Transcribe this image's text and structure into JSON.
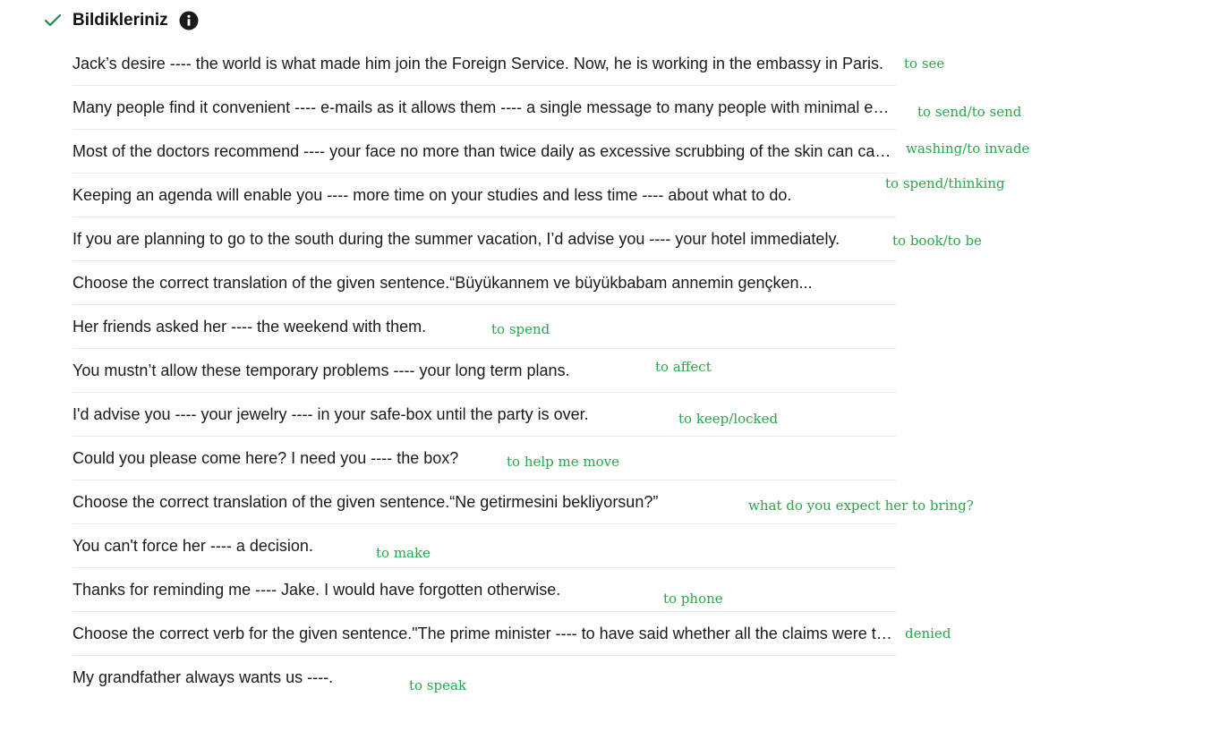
{
  "header": {
    "title": "Bildikleriniz",
    "check_icon": "check-icon",
    "info_icon": "info-icon",
    "accent_color": "#1f8b4c"
  },
  "answer_color": "#2aa64a",
  "questions": [
    {
      "text": "Jack’s desire ---- the world is what made him join the Foreign Service. Now, he is working in the embassy in Paris.",
      "answer": "to see"
    },
    {
      "text": "Many people find it convenient ---- e-mails as it allows them ---- a single message to many people with minimal effort.",
      "answer": "to send/to send"
    },
    {
      "text": "Most of the doctors recommend ---- your face no more than twice daily as excessive scrubbing of the skin can cause irritation.",
      "answer": "washing/to invade"
    },
    {
      "text": "Keeping an agenda will enable you ---- more time on your studies and less time ---- about what to do.",
      "answer": "to spend/thinking"
    },
    {
      "text": "If you are planning to go to the south during the summer vacation, I’d advise you ---- your hotel immediately.",
      "answer": "to book/to be"
    },
    {
      "text": "Choose the correct translation of the given sentence.“Büyükannem ve büyükbabam annemin gençken...",
      "answer": ""
    },
    {
      "text": "Her friends asked her ---- the weekend with them.",
      "answer": "to spend"
    },
    {
      "text": "You mustn’t allow these temporary problems ---- your long term plans.",
      "answer": "to affect"
    },
    {
      "text": "I'd advise you ---- your jewelry ---- in your safe-box until the party is over.",
      "answer": "to keep/locked"
    },
    {
      "text": "Could you please come here? I need you ---- the box?",
      "answer": "to help me move"
    },
    {
      "text": "Choose the correct translation of the given sentence.“Ne getirmesini bekliyorsun?”",
      "answer": "what do you expect her to bring?"
    },
    {
      "text": "You can't force her ---- a decision.",
      "answer": "to make"
    },
    {
      "text": "Thanks for reminding me ---- Jake. I would have forgotten otherwise.",
      "answer": "to phone"
    },
    {
      "text": "Choose the correct verb for the given sentence.\"The prime minister ---- to have said whether all the claims were true.",
      "answer": "denied"
    },
    {
      "text": "My grandfather always wants us ----.",
      "answer": "to speak"
    }
  ]
}
